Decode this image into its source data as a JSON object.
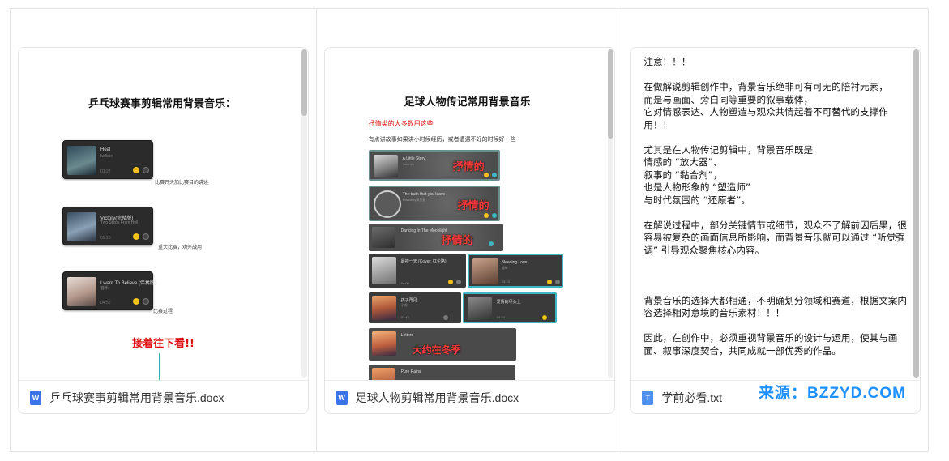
{
  "files": [
    {
      "name": "乒乓球赛事剪辑常用背景音乐.docx",
      "type": "word",
      "icon": "word-doc-icon",
      "preview": {
        "title": "乒乓球赛事剪辑常用背景音乐：",
        "tracks": [
          {
            "title": "Heal",
            "sub": "Iwilldie",
            "time": "01:27",
            "caption": "比赛开头加比赛目的讲述"
          },
          {
            "title": "Victory(完整版)",
            "sub": "Two Steps From Hell",
            "time": "05:20",
            "caption": "重大比赛，劝外战用"
          },
          {
            "title": "I want To Believe (伴奏版)",
            "sub": "音乐",
            "time": "04:52",
            "caption": "比赛过程"
          }
        ],
        "next_note": "接着往下看!!"
      }
    },
    {
      "name": "足球人物剪辑常用背景音乐.docx",
      "type": "word",
      "icon": "word-doc-icon",
      "preview": {
        "title": "足球人物传记常用背景音乐",
        "red_line": "抒情类的大多数用这些",
        "gray_line": "有点讲故事如果讲小时候经历，或者遭遇不好的时候好一些",
        "tracks": [
          {
            "title": "A Little Story",
            "sub": "Valentin",
            "overlay": "抒情的"
          },
          {
            "title": "The truth that you leave",
            "sub": "Pianoboy高至豪",
            "overlay": "抒情的"
          },
          {
            "title": "Dancing In The Moonlight",
            "sub": "",
            "overlay": "抒情的"
          },
          {
            "title": "最初一天 (Cover: 红尘路)",
            "sub": "",
            "time": "04:09"
          },
          {
            "title": "Bleeding Love",
            "sub": "钢琴",
            "time": "03:19"
          },
          {
            "title": "孩子再见",
            "sub": "小虎",
            "time": "03:42"
          },
          {
            "title": "爱情的尽头上",
            "sub": "",
            "time": "04:20"
          },
          {
            "title": "Letters",
            "sub": "",
            "overlay": "大约在冬季"
          },
          {
            "title": "Pure Rains",
            "sub": ""
          }
        ]
      }
    },
    {
      "name": "学前必看.txt",
      "type": "txt",
      "icon": "text-file-icon",
      "preview": {
        "paragraphs": [
          [
            "注意！！！"
          ],
          [
            "在做解说剪辑创作中，背景音乐绝非可有可无的陪衬元素，",
            "而是与画面、旁白同等重要的叙事载体，",
            "它对情感表达、人物塑造与观众共情起着不可替代的支撑作用！！"
          ],
          [
            "尤其是在人物传记剪辑中，背景音乐既是",
            "情感的 “放大器”、",
            "叙事的 “黏合剂”，",
            "也是人物形象的 “塑造师”",
            "与时代氛围的 “还原者”。"
          ],
          [
            "在解说过程中，部分关键情节或细节，观众不了解前因后果，很容易被复杂的画面信息所影响，而背景音乐就可以通过 “听觉强调” 引导观众聚焦核心内容。"
          ],
          [
            ""
          ],
          [
            "背景音乐的选择大都相通，不明确划分领域和赛道，根据文案内容选择相对意境的音乐素材！！！"
          ],
          [
            "因此，在创作中，必须重视背景音乐的设计与运用，使其与画面、叙事深度契合，共同成就一部优秀的作品。"
          ]
        ]
      }
    }
  ],
  "watermark": "来源：BZZYD.COM",
  "colors": {
    "accent_red": "#e01010",
    "word_blue": "#3b74e8",
    "watermark_blue": "#1e90ff",
    "teal": "#33b3b3"
  }
}
